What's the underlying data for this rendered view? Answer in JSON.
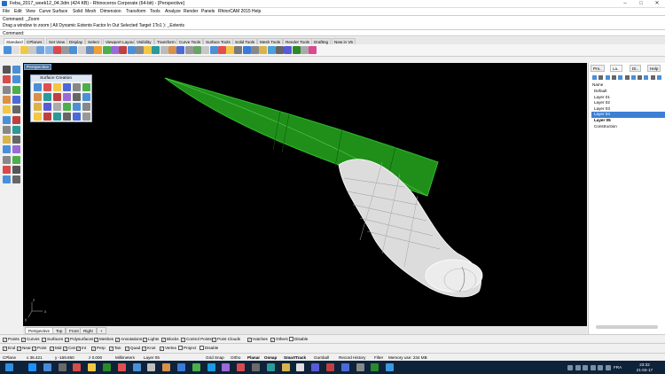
{
  "window": {
    "title": "Feba_2017_week12_04.3dm (424 KB) - Rhinoceros Corporate (64-bit) - [Perspective]",
    "min": "–",
    "max": "□",
    "close": "✕"
  },
  "menu": [
    "File",
    "Edit",
    "View",
    "Curve",
    "Surface",
    "Solid",
    "Mesh",
    "Dimension",
    "Transform",
    "Tools",
    "Analyze",
    "Render",
    "Panels",
    "RhinoCAM 2015",
    "Help"
  ],
  "command_history": [
    "Command: _Zoom",
    "Drag a window to zoom ( All  Dynamic  Extents  Factor  In  Out  Selected  Target  1To1 ): _Extents"
  ],
  "command_prompt": "Command:",
  "toolbar_tabs": [
    "Standard",
    "CPlanes",
    "Set View",
    "Display",
    "Select",
    "Viewport Layout",
    "Visibility",
    "Transform",
    "Curve Tools",
    "Surface Tools",
    "Solid Tools",
    "Mesh Tools",
    "Render Tools",
    "Drafting",
    "New in V5"
  ],
  "viewport": {
    "label": "Perspective",
    "axis_x": "x",
    "axis_y": "y",
    "axis_z": "z"
  },
  "surface_panel": {
    "title": "Surface Creation"
  },
  "view_tabs": [
    "Perspective",
    "Top",
    "Front",
    "Right",
    "+"
  ],
  "osnap_row1": [
    {
      "label": "Points",
      "checked": true
    },
    {
      "label": "Curves",
      "checked": true
    },
    {
      "label": "Surfaces",
      "checked": true
    },
    {
      "label": "Polysurfaces",
      "checked": true
    },
    {
      "label": "Meshes",
      "checked": true
    },
    {
      "label": "Annotations",
      "checked": true
    },
    {
      "label": "Lights",
      "checked": true
    },
    {
      "label": "Blocks",
      "checked": true
    },
    {
      "label": "Control Points",
      "checked": true
    },
    {
      "label": "Point Clouds",
      "checked": true
    },
    {
      "label": "Hatches",
      "checked": true
    },
    {
      "label": "Others",
      "checked": true
    },
    {
      "label": "Disable",
      "checked": false
    }
  ],
  "osnap_row2": [
    {
      "label": "End",
      "checked": true
    },
    {
      "label": "Near",
      "checked": true
    },
    {
      "label": "Point",
      "checked": true
    },
    {
      "label": "Mid",
      "checked": true
    },
    {
      "label": "Cen",
      "checked": true
    },
    {
      "label": "Int",
      "checked": true
    },
    {
      "label": "Perp",
      "checked": true
    },
    {
      "label": "Tan",
      "checked": true
    },
    {
      "label": "Quad",
      "checked": true
    },
    {
      "label": "Knot",
      "checked": true
    },
    {
      "label": "Vertex",
      "checked": true
    },
    {
      "label": "Project",
      "checked": false
    },
    {
      "label": "Disable",
      "checked": false
    }
  ],
  "status": {
    "cplane": "CPlane",
    "x": "x 36.421",
    "y": "y -169.850",
    "z": "z 0.000",
    "units": "Millimeters",
    "layer": "Layer 05",
    "grid_snap": "Grid Snap",
    "ortho": "Ortho",
    "planar": "Planar",
    "osnap": "Osnap",
    "smarttrack": "SmartTrack",
    "gumball": "Gumball",
    "record_history": "Record History",
    "filter": "Filter",
    "memory": "Memory use: 234 MB"
  },
  "right_panel": {
    "tabs": [
      "Pro..",
      "La..",
      "Di..",
      "Help"
    ],
    "column": "Name",
    "layers": [
      {
        "name": "Default",
        "selected": false,
        "bold": false
      },
      {
        "name": "Layer 01",
        "selected": false,
        "bold": false
      },
      {
        "name": "Layer 02",
        "selected": false,
        "bold": false
      },
      {
        "name": "Layer 03",
        "selected": false,
        "bold": false
      },
      {
        "name": "Layer 04",
        "selected": true,
        "bold": false
      },
      {
        "name": "Layer 05",
        "selected": false,
        "bold": true
      },
      {
        "name": "Construction",
        "selected": false,
        "bold": false
      }
    ]
  },
  "taskbar": {
    "lang": "FRA",
    "time": "23:32",
    "date": "21-04-17"
  },
  "colors": {
    "viewport_bg": "#000000",
    "green_surface": "#1f8f1a",
    "white_surface": "#e8e8e8",
    "selection": "#3c7fd6"
  }
}
